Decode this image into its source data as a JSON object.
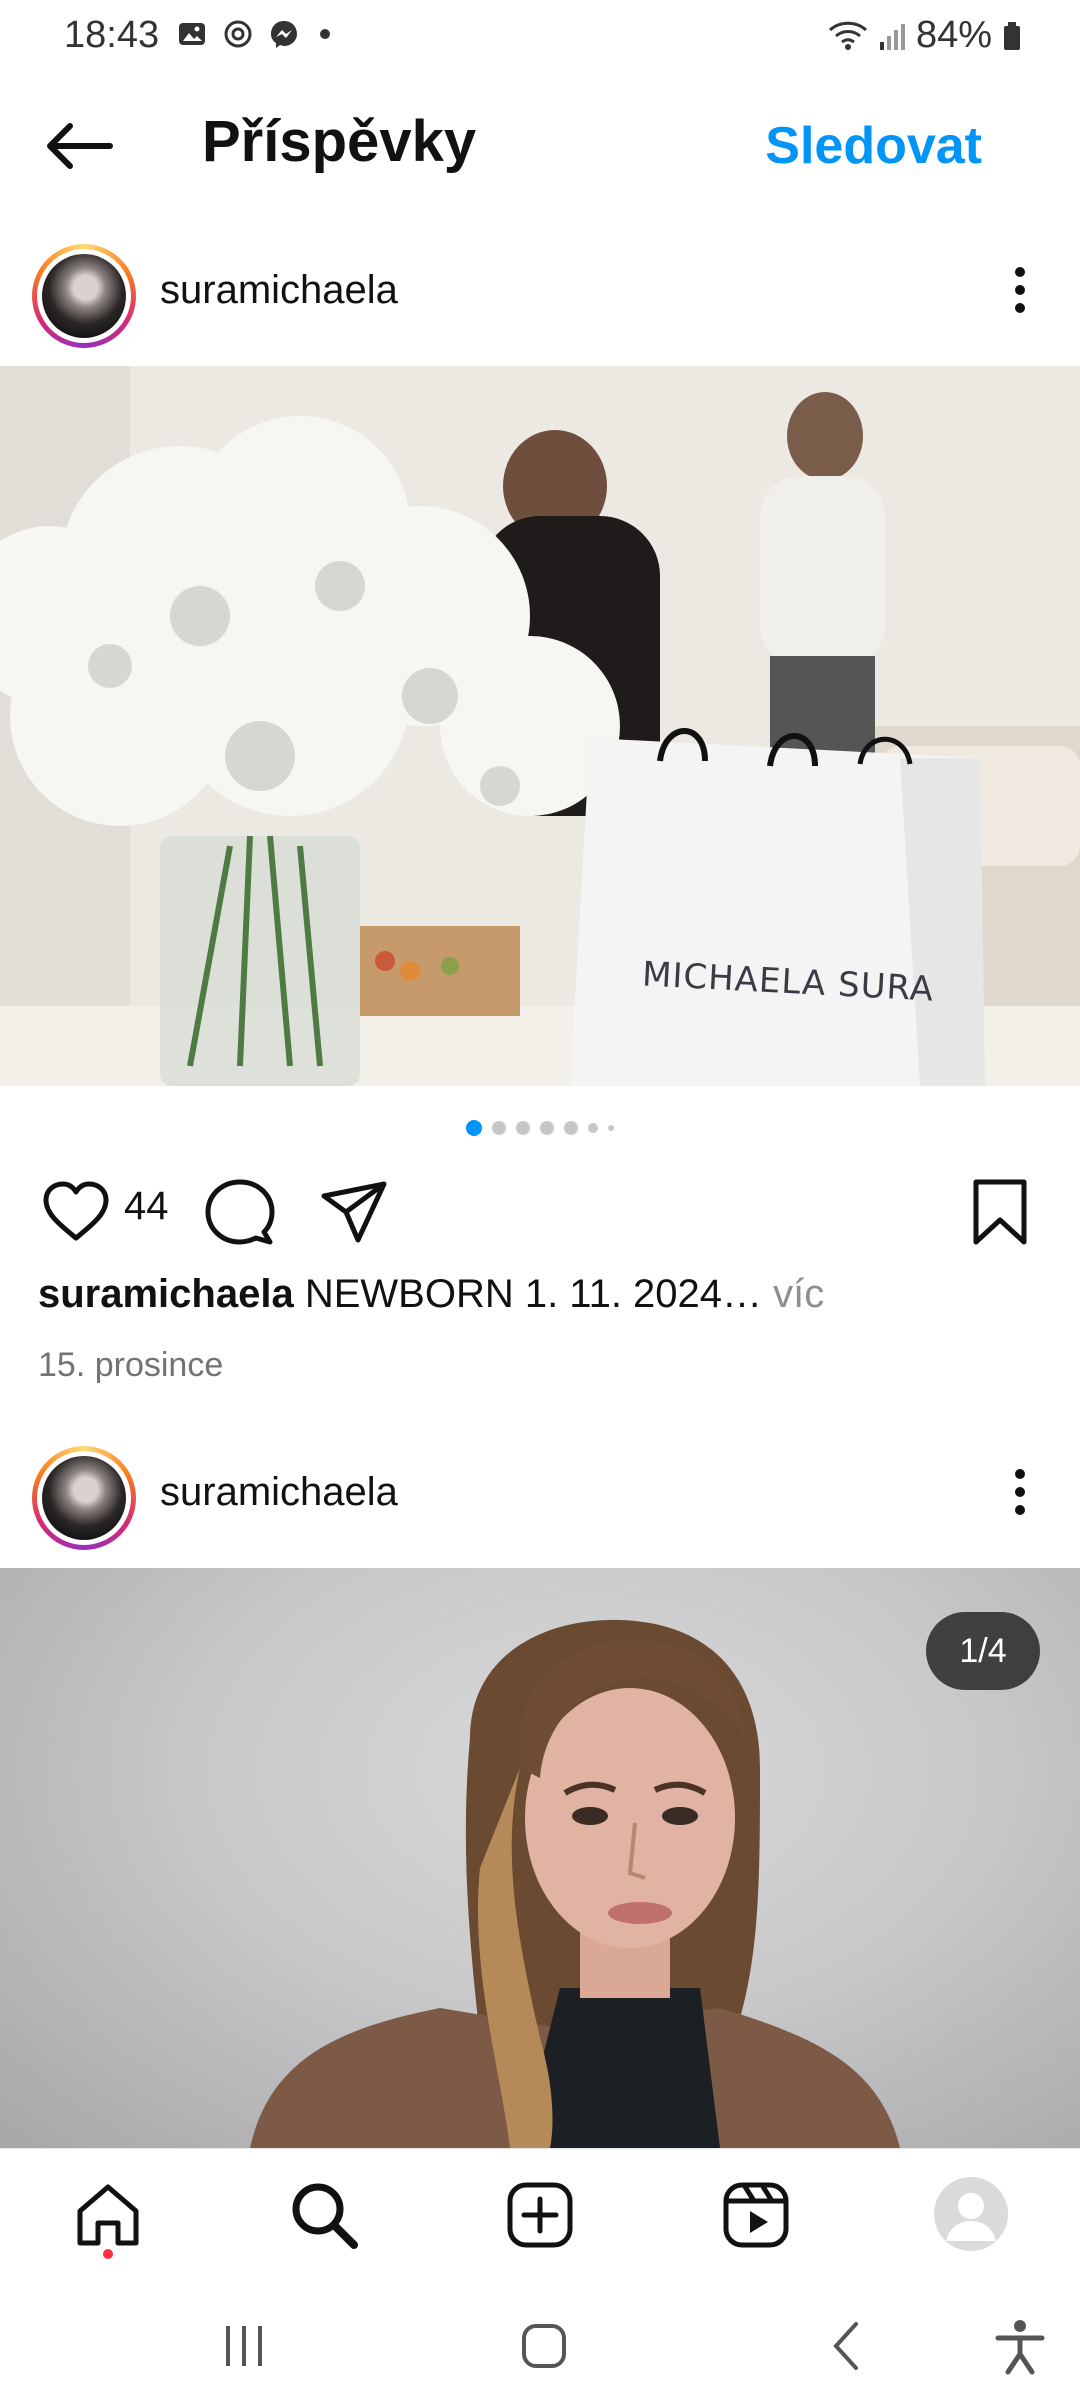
{
  "status_bar": {
    "time": "18:43",
    "battery": "84%",
    "icons_left": [
      "gallery-icon",
      "sync-icon",
      "messenger-icon"
    ],
    "icons_right": [
      "wifi-icon",
      "signal-icon",
      "battery-icon"
    ]
  },
  "header": {
    "title": "Příspěvky",
    "follow_label": "Sledovat"
  },
  "posts": [
    {
      "username": "suramichaela",
      "carousel": {
        "dots": 7,
        "active": 1
      },
      "likes": "44",
      "caption_user": "suramichaela",
      "caption_text": "NEWBORN 1. 11. 2024…",
      "more_label": "víc",
      "date": "15. prosince",
      "image_text": "MICHAELA SURA"
    },
    {
      "username": "suramichaela",
      "counter": "1/4"
    }
  ],
  "bottom_nav": [
    "home-icon",
    "search-icon",
    "create-icon",
    "reels-icon",
    "profile-icon"
  ],
  "system_nav": [
    "recents-icon",
    "home-icon",
    "back-icon",
    "accessibility-icon"
  ],
  "colors": {
    "accent": "#0095f6",
    "notification": "#ff3040"
  }
}
